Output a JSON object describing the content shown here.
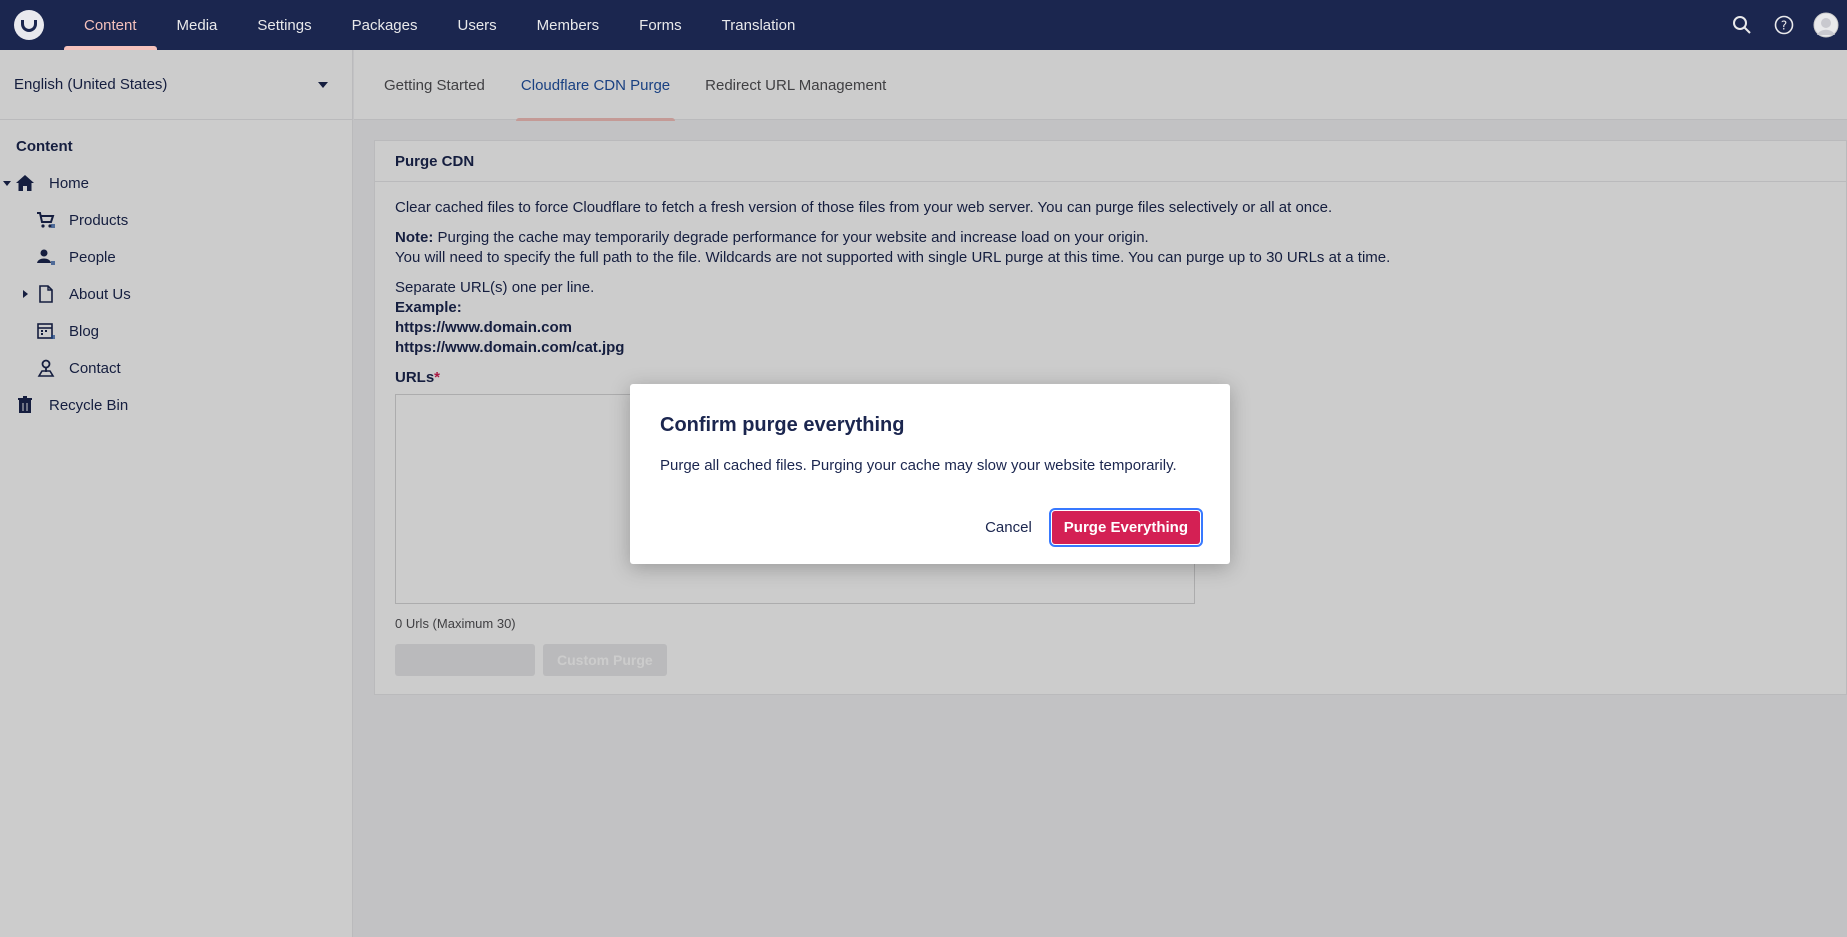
{
  "topnav": {
    "items": [
      "Content",
      "Media",
      "Settings",
      "Packages",
      "Users",
      "Members",
      "Forms",
      "Translation"
    ],
    "active_index": 0,
    "icons": [
      "search-icon",
      "help-icon",
      "user-avatar"
    ]
  },
  "sidebar": {
    "language": "English (United States)",
    "section_title": "Content",
    "tree": [
      {
        "label": "Home",
        "icon": "home-icon",
        "expanded": true
      },
      {
        "label": "Products",
        "icon": "cart-icon"
      },
      {
        "label": "People",
        "icon": "people-icon"
      },
      {
        "label": "About Us",
        "icon": "document-icon",
        "collapsed": true
      },
      {
        "label": "Blog",
        "icon": "calendar-icon"
      },
      {
        "label": "Contact",
        "icon": "map-pin-icon"
      },
      {
        "label": "Recycle Bin",
        "icon": "trash-icon"
      }
    ]
  },
  "tabs": {
    "items": [
      "Getting Started",
      "Cloudflare CDN Purge",
      "Redirect URL Management"
    ],
    "active_index": 1
  },
  "panel": {
    "title": "Purge CDN",
    "intro": "Clear cached files to force Cloudflare to fetch a fresh version of those files from your web server. You can purge files selectively or all at once.",
    "note_label": "Note:",
    "note_text": " Purging the cache may temporarily degrade performance for your website and increase load on your origin.",
    "note_text2": "You will need to specify the full path to the file. Wildcards are not supported with single URL purge at this time. You can purge up to 30 URLs at a time.",
    "separate": "Separate URL(s) one per line.",
    "example_label": "Example:",
    "example1": "https://www.domain.com",
    "example2": "https://www.domain.com/cat.jpg",
    "urls_label": "URLs",
    "required_mark": "*",
    "count": "0 Urls (Maximum 30)",
    "custom_purge": "Custom Purge"
  },
  "modal": {
    "title": "Confirm purge everything",
    "text": "Purge all cached files. Purging your cache may slow your website temporarily.",
    "cancel": "Cancel",
    "confirm": "Purge Everything"
  },
  "colors": {
    "topbar": "#1b264f",
    "accent": "#d42054",
    "active_tab": "#f5c1bc"
  }
}
